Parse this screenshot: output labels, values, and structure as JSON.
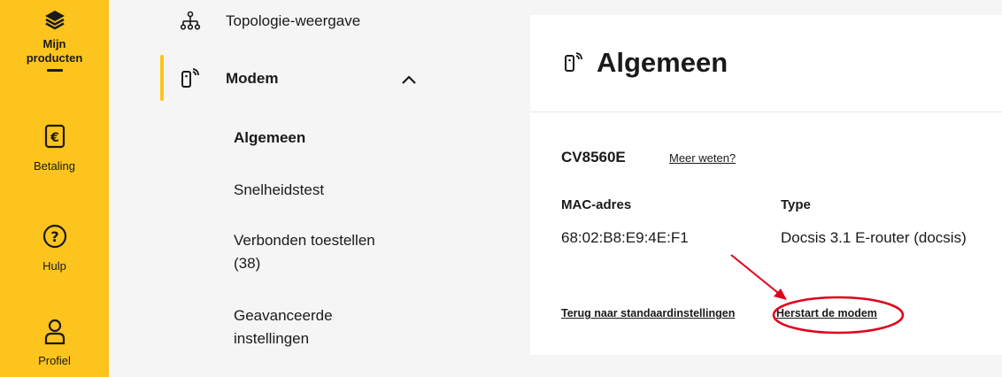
{
  "rail": {
    "items": [
      {
        "label": "Mijn producten",
        "icon": "layers-icon"
      },
      {
        "label": "Betaling",
        "icon": "euro-icon"
      },
      {
        "label": "Hulp",
        "icon": "help-icon"
      },
      {
        "label": "Profiel",
        "icon": "profile-icon"
      }
    ]
  },
  "subnav": {
    "topology": "Topologie-weergave",
    "modem": "Modem",
    "items": [
      "Algemeen",
      "Snelheidstest",
      "Verbonden toestellen (38)",
      "Geavanceerde instellingen"
    ]
  },
  "card": {
    "title": "Algemeen",
    "model": "CV8560E",
    "more_link": "Meer weten?",
    "mac_label": "MAC-adres",
    "mac_value": "68:02:B8:E9:4E:F1",
    "type_label": "Type",
    "type_value": "Docsis 3.1 E-router (docsis)",
    "reset_link": "Terug naar standaardinstellingen",
    "restart_link": "Herstart de modem"
  },
  "colors": {
    "accent": "#fdc41d",
    "annotation": "#e0001b"
  }
}
